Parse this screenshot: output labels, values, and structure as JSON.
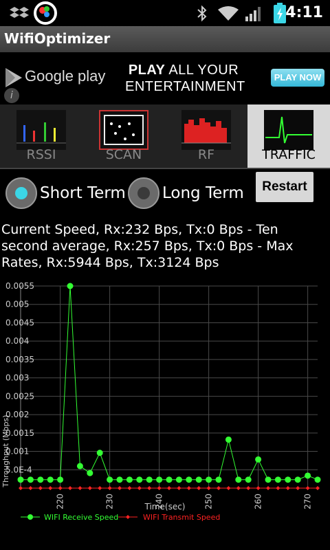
{
  "status_bar": {
    "time": "4:11",
    "icons": [
      "dropbox-icon",
      "app-icon",
      "bluetooth-icon",
      "wifi-icon",
      "signal-icon",
      "battery-charging-icon"
    ]
  },
  "app": {
    "title": "WifiOptimizer"
  },
  "ad": {
    "brand": "Google play",
    "line1_bold": "PLAY",
    "line1_rest": " ALL YOUR",
    "line2": "ENTERTAINMENT",
    "cta": "PLAY NOW"
  },
  "tabs": [
    {
      "label": "RSSI",
      "active": false
    },
    {
      "label": "SCAN",
      "active": false
    },
    {
      "label": "RF",
      "active": false
    },
    {
      "label": "TRAFFIC",
      "active": true
    }
  ],
  "mode": {
    "options": [
      {
        "label": "Short Term",
        "selected": true
      },
      {
        "label": "Long Term",
        "selected": false
      }
    ],
    "restart_label": "Restart"
  },
  "speed_text": "Current Speed, Rx:232 Bps, Tx:0 Bps - Ten second average, Rx:257 Bps, Tx:0 Bps - Max Rates, Rx:5944 Bps, Tx:3124 Bps",
  "colors": {
    "receive": "#33ff33",
    "transmit": "#ff2222",
    "grid": "#4a4a4a",
    "axis": "#cccccc"
  },
  "chart_data": {
    "type": "line",
    "xlabel": "Time(sec)",
    "ylabel": "Throughput (Mbps)",
    "xlim": [
      212,
      272
    ],
    "ylim": [
      0,
      0.0055
    ],
    "x_ticks": [
      220,
      230,
      240,
      250,
      260,
      270
    ],
    "y_ticks": [
      "0.0055",
      "0.005",
      "0.0045",
      "0.004",
      "0.0035",
      "0.003",
      "0.0025",
      "0.002",
      "0.0015",
      "0.001",
      "5.0E-4"
    ],
    "y_tick_values": [
      0.0055,
      0.005,
      0.0045,
      0.004,
      0.0035,
      0.003,
      0.0025,
      0.002,
      0.0015,
      0.001,
      0.0005
    ],
    "grid": true,
    "legend_position": "bottom",
    "series": [
      {
        "name": "WIFI Receive Speed",
        "x": [
          212,
          214,
          216,
          218,
          220,
          222,
          224,
          226,
          228,
          230,
          232,
          234,
          236,
          238,
          240,
          242,
          244,
          246,
          248,
          250,
          252,
          254,
          256,
          258,
          260,
          262,
          264,
          266,
          268,
          270,
          272
        ],
        "values": [
          0.00023,
          0.00023,
          0.00023,
          0.00023,
          0.00023,
          0.0055,
          0.0006,
          0.00041,
          0.00096,
          0.00023,
          0.00023,
          0.00023,
          0.00023,
          0.00023,
          0.00023,
          0.00023,
          0.00023,
          0.00023,
          0.00023,
          0.00023,
          0.00023,
          0.00132,
          0.00023,
          0.00023,
          0.00078,
          0.00023,
          0.00023,
          0.00023,
          0.00023,
          0.00034,
          0.00023
        ]
      },
      {
        "name": "WIFI Transmit Speed",
        "x": [
          212,
          214,
          216,
          218,
          220,
          222,
          224,
          226,
          228,
          230,
          232,
          234,
          236,
          238,
          240,
          242,
          244,
          246,
          248,
          250,
          252,
          254,
          256,
          258,
          260,
          262,
          264,
          266,
          268,
          270,
          272
        ],
        "values": [
          0,
          0,
          0,
          0,
          0,
          0,
          0,
          0,
          0,
          0,
          0,
          0,
          0,
          0,
          0,
          0,
          0,
          0,
          0,
          0,
          0,
          0,
          0,
          0,
          0,
          0,
          0,
          0,
          0,
          0,
          0
        ]
      }
    ]
  }
}
